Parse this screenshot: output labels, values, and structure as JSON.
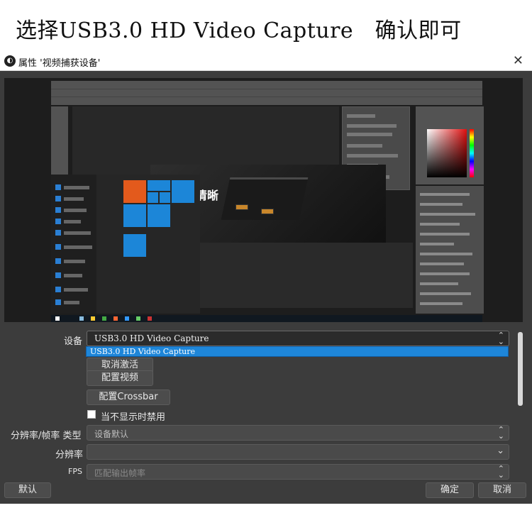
{
  "banner": {
    "text": "选择USB3.0 HD Video Capture　确认即可"
  },
  "window": {
    "title": "属性 '视频捕获设备'",
    "close_glyph": "✕"
  },
  "preview": {
    "headline": "清晰"
  },
  "form": {
    "device_label": "设备",
    "device_value": "USB3.0 HD Video Capture",
    "device_option_highlighted": "USB3.0 HD Video Capture",
    "deactivate_button": "取消激活",
    "config_video_button": "配置视频",
    "config_crossbar_button": "配置Crossbar",
    "hide_checkbox_label": "当不显示时禁用",
    "res_fps_type_label": "分辨率/帧率 类型",
    "res_fps_type_value": "设备默认",
    "resolution_label": "分辨率",
    "resolution_value": "",
    "fps_label": "FPS",
    "fps_value": "匹配输出帧率"
  },
  "footer": {
    "defaults_button": "默认",
    "ok_button": "确定",
    "cancel_button": "取消"
  },
  "icons": {
    "updown": "⌃⌄",
    "chevron": "⌄"
  },
  "colors": {
    "window_bg": "#3c3c3c",
    "highlight": "#1e86d9",
    "tile_orange": "#e35a1c",
    "tile_blue": "#1c86d8"
  }
}
